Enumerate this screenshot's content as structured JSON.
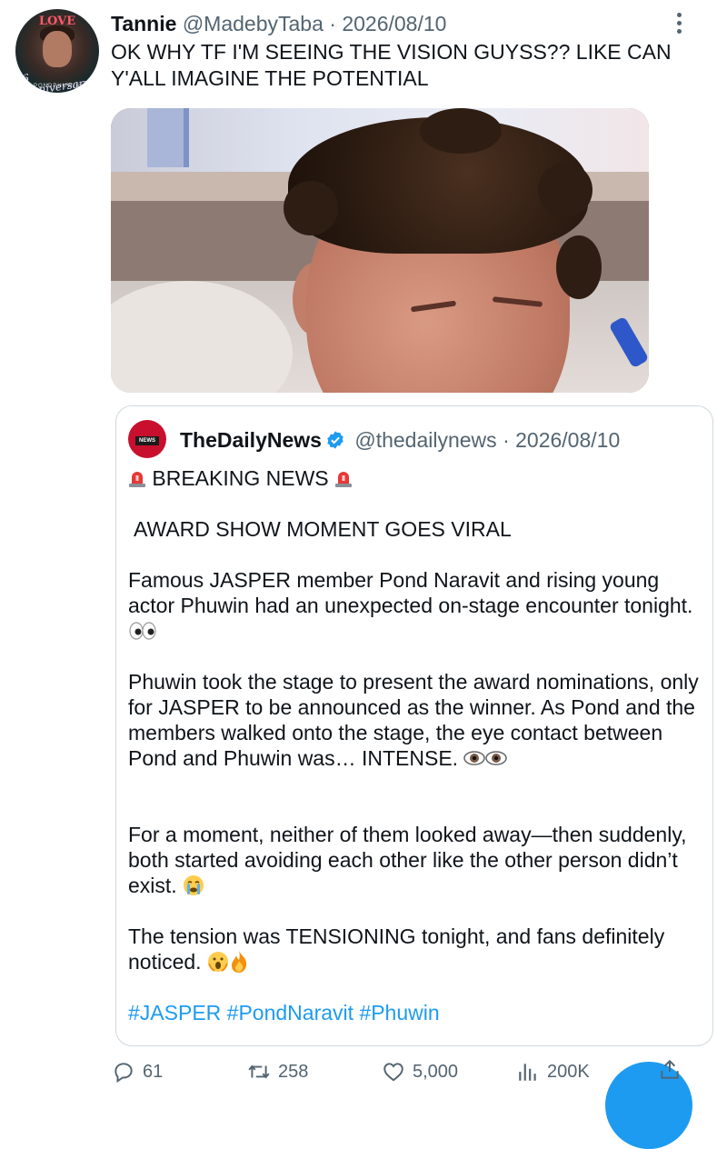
{
  "tweet": {
    "display_name": "Tannie",
    "handle": "@MadebyTaba",
    "separator": "·",
    "date": "2026/08/10",
    "text": "OK WHY TF I'M SEEING THE VISION GUYSS?? LIKE CAN Y'ALL IMAGINE THE POTENTIAL",
    "avatar": {
      "top_text": "LOVE",
      "anniversary_text": "6 Anniversary",
      "bottom_text": "PONDPHUWIN"
    }
  },
  "quoted_tweet": {
    "display_name": "TheDailyNews",
    "handle": "@thedailynews",
    "separator": "·",
    "date": "2026/08/10",
    "avatar_text": "NEWS",
    "breaking": "BREAKING NEWS",
    "headline": "AWARD SHOW MOMENT GOES VIRAL",
    "para1": "Famous JASPER member Pond Naravit and rising young actor Phuwin had an unexpected on-stage encounter tonight.",
    "para2": "Phuwin took the stage to present the award nominations, only for JASPER to be announced as the winner. As Pond and the members walked onto the stage, the eye contact between Pond and Phuwin was… INTENSE.",
    "para3": "For a moment, neither of them looked away—then suddenly, both started avoiding each other like the other person didn’t exist.",
    "para4": "The tension was TENSIONING tonight, and fans definitely noticed.",
    "hashtags": "#JASPER #PondNaravit #Phuwin"
  },
  "actions": {
    "replies": "61",
    "retweets": "258",
    "likes": "5,000",
    "views": "200K"
  },
  "icons": [
    "more-icon",
    "verified-icon",
    "siren-icon",
    "reply-icon",
    "retweet-icon",
    "like-icon",
    "views-icon",
    "share-icon"
  ],
  "colors": {
    "accent": "#1d9bf0",
    "text": "#0f1419",
    "muted": "#536471",
    "border": "#cfd9de"
  }
}
